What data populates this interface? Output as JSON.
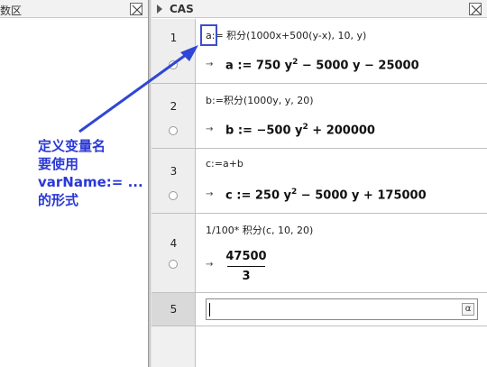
{
  "left_panel": {
    "title": "数区"
  },
  "cas": {
    "title": "CAS",
    "rows": [
      {
        "num": "1",
        "input": "a:= 积分(1000x+500(y-x), 10, y)",
        "output_label": "a",
        "output_expr": ":= 750 y",
        "output_exp": "2",
        "output_rest": " − 5000 y − 25000"
      },
      {
        "num": "2",
        "input": "b:=积分(1000y, y, 20)",
        "output_label": "b",
        "output_expr": ":= −500 y",
        "output_exp": "2",
        "output_rest": " + 200000"
      },
      {
        "num": "3",
        "input": "c:=a+b",
        "output_label": "c",
        "output_expr": ":= 250 y",
        "output_exp": "2",
        "output_rest": " − 5000 y + 175000"
      },
      {
        "num": "4",
        "input": "1/100* 积分(c, 10, 20)",
        "frac_num": "47500",
        "frac_den": "3"
      },
      {
        "num": "5",
        "input_value": ""
      }
    ],
    "arrow_symbol": "→",
    "alpha_symbol": "α"
  },
  "annotation": {
    "lines": [
      "定义变量名",
      "要使用",
      "varName:= ...",
      "的形式"
    ],
    "color": "#2a38d6"
  }
}
